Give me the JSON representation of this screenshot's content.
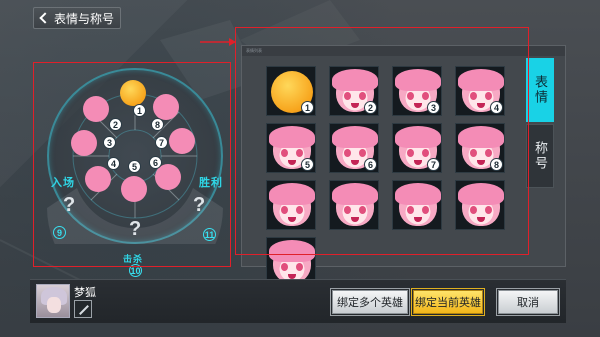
{
  "header": {
    "back_label": "表情与称号"
  },
  "wheel": {
    "left_caption": "入场",
    "right_caption": "胜利",
    "bottom_caption": "击杀",
    "empty_slot_mark": "?",
    "center_slot_numbers": [
      "1",
      "2",
      "3",
      "4",
      "5",
      "6",
      "7",
      "8"
    ],
    "outer_slot_numbers": [
      "9",
      "10",
      "11"
    ]
  },
  "panel": {
    "header_text": "表情列表",
    "cells": [
      {
        "kind": "yellow",
        "badge": "1"
      },
      {
        "kind": "pink",
        "badge": "2"
      },
      {
        "kind": "pink",
        "badge": "3"
      },
      {
        "kind": "pink",
        "badge": "4"
      },
      {
        "kind": "pink",
        "badge": "5"
      },
      {
        "kind": "pink",
        "badge": "6"
      },
      {
        "kind": "pink",
        "badge": "7"
      },
      {
        "kind": "pink",
        "badge": "8"
      },
      {
        "kind": "pink",
        "badge": ""
      },
      {
        "kind": "pink",
        "badge": ""
      },
      {
        "kind": "pink",
        "badge": ""
      },
      {
        "kind": "pink",
        "badge": ""
      },
      {
        "kind": "pink",
        "badge": ""
      }
    ]
  },
  "tabs": [
    {
      "label": "表情",
      "active": true
    },
    {
      "label": "称号",
      "active": false
    }
  ],
  "hero": {
    "name": "梦狐"
  },
  "buttons": {
    "bind_multiple": "绑定多个英雄",
    "bind_current": "绑定当前英雄",
    "cancel": "取消"
  },
  "colors": {
    "accent": "#19d2e6",
    "highlight_box": "#e0202a",
    "gold_button": "#f2b61a"
  }
}
